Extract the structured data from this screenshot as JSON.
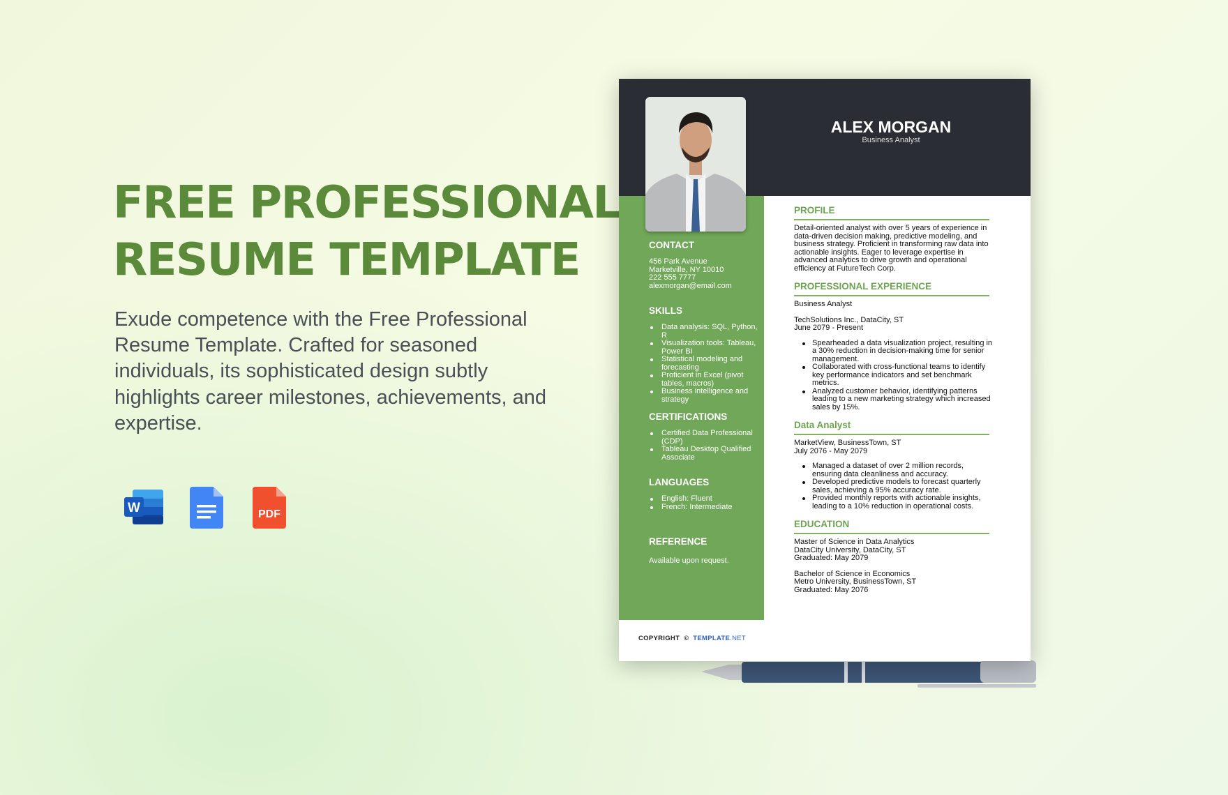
{
  "hero": {
    "title_line1": "FREE PROFESSIONAL",
    "title_line2": "RESUME TEMPLATE",
    "description": "Exude competence with the Free Professional Resume Template. Crafted for seasoned individuals, its sophisticated design subtly highlights career milestones, achievements, and expertise.",
    "formats": [
      {
        "icon": "word-icon",
        "label": "W"
      },
      {
        "icon": "google-docs-icon"
      },
      {
        "icon": "pdf-icon",
        "label": "PDF"
      }
    ]
  },
  "resume": {
    "name": "ALEX MORGAN",
    "role": "Business Analyst",
    "contact": {
      "heading": "CONTACT",
      "lines": [
        "456 Park Avenue",
        "Marketville, NY 10010",
        "222 555 7777",
        "alexmorgan@email.com"
      ]
    },
    "skills": {
      "heading": "SKILLS",
      "items": [
        "Data analysis: SQL, Python, R",
        "Visualization tools: Tableau, Power BI",
        "Statistical modeling and forecasting",
        "Proficient in Excel (pivot tables, macros)",
        "Business intelligence and strategy"
      ]
    },
    "certifications": {
      "heading": "CERTIFICATIONS",
      "items": [
        "Certified Data Professional (CDP)",
        "Tableau Desktop Qualified Associate"
      ]
    },
    "languages": {
      "heading": "LANGUAGES",
      "items": [
        "English: Fluent",
        "French: Intermediate"
      ]
    },
    "reference": {
      "heading": "REFERENCE",
      "text": "Available upon request."
    },
    "profile": {
      "heading": "PROFILE",
      "text": "Detail-oriented analyst with over 5 years of experience in data-driven decision making, predictive modeling, and business strategy. Proficient in transforming raw data into actionable insights. Eager to leverage expertise in advanced analytics to drive growth and operational efficiency at FutureTech Corp."
    },
    "experience": {
      "heading": "PROFESSIONAL EXPERIENCE",
      "job1": {
        "title": "Business Analyst",
        "company": "TechSolutions Inc., DataCity, ST",
        "dates": "June 2079 - Present",
        "bullets": [
          "Spearheaded a data visualization project, resulting in a 30% reduction in decision-making time for senior management.",
          "Collaborated with cross-functional teams to identify key performance indicators and set benchmark metrics.",
          "Analyzed customer behavior, identifying patterns leading to a new marketing strategy which increased sales by 15%."
        ]
      },
      "job2": {
        "title": "Data Analyst",
        "company": "MarketView, BusinessTown, ST",
        "dates": "July 2076 - May 2079",
        "bullets": [
          "Managed a dataset of over 2 million records, ensuring data cleanliness and accuracy.",
          "Developed predictive models to forecast quarterly sales, achieving a 95% accuracy rate.",
          "Provided monthly reports with actionable insights, leading to a 10% reduction in operational costs."
        ]
      }
    },
    "education": {
      "heading": "EDUCATION",
      "entries": [
        [
          "Master of Science in Data Analytics",
          "DataCity University, DataCity, ST",
          "Graduated: May 2079"
        ],
        [
          "Bachelor of Science in Economics",
          "Metro University, BusinessTown, ST",
          "Graduated: May 2076"
        ]
      ]
    },
    "footer": {
      "copyright": "COPYRIGHT",
      "symbol": "©",
      "brand": "TEMPLATE",
      "brand_suffix": ".NET"
    }
  },
  "colors": {
    "accent_green": "#71a758",
    "title_green": "#5a8a3a",
    "header_dark": "#2a2d33",
    "brand_blue": "#2d5fd0"
  }
}
